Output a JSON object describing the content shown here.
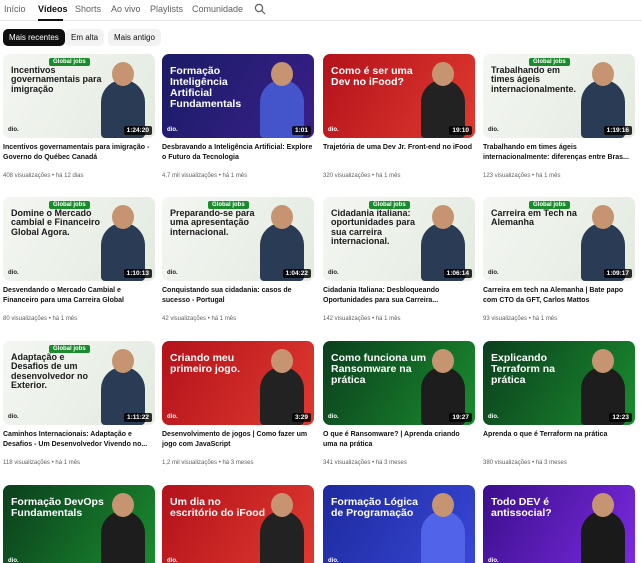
{
  "tabs": [
    {
      "label": "Início"
    },
    {
      "label": "Vídeos"
    },
    {
      "label": "Shorts"
    },
    {
      "label": "Ao vivo"
    },
    {
      "label": "Playlists"
    },
    {
      "label": "Comunidade"
    }
  ],
  "search_icon": "search-icon",
  "chips": [
    {
      "label": "Mais recentes",
      "selected": true
    },
    {
      "label": "Em alta",
      "selected": false
    },
    {
      "label": "Mais antigo",
      "selected": false
    }
  ],
  "videos": [
    {
      "title": "Incentivos governamentais para imigração - Governo do Québec Canadá",
      "views": "408 visualizações",
      "age": "há 12 dias",
      "duration": "1:24:20",
      "thumb_text": "Incentivos governamentais para imigração",
      "theme": "light"
    },
    {
      "title": "Desbravando a Inteligência Artificial: Explore o Futuro da Tecnologia",
      "views": "4,7 mil visualizações",
      "age": "há 1 mês",
      "duration": "1:01",
      "thumb_text": "Formação Inteligência Artificial Fundamentals",
      "theme": "navy"
    },
    {
      "title": "Trajetória de uma Dev Jr. Front-end no iFood",
      "views": "320 visualizações",
      "age": "há 1 mês",
      "duration": "19:10",
      "thumb_text": "Como é ser uma Dev no iFood?",
      "theme": "red"
    },
    {
      "title": "Trabalhando em times ágeis internacionalmente: diferenças entre Bras...",
      "views": "123 visualizações",
      "age": "há 1 mês",
      "duration": "1:19:16",
      "thumb_text": "Trabalhando em times ágeis internacionalmente.",
      "theme": "light"
    },
    {
      "title": "Desvendando o Mercado Cambial e Financeiro para uma Carreira Global",
      "views": "80 visualizações",
      "age": "há 1 mês",
      "duration": "1:10:13",
      "thumb_text": "Domine o Mercado cambial e Financeiro Global Agora.",
      "theme": "light"
    },
    {
      "title": "Conquistando sua cidadania: casos de sucesso - Portugal",
      "views": "42 visualizações",
      "age": "há 1 mês",
      "duration": "1:04:22",
      "thumb_text": "Preparando-se para uma apresentação internacional.",
      "theme": "light"
    },
    {
      "title": "Cidadania Italiana: Desbloqueando Oportunidades para sua Carreira...",
      "views": "142 visualizações",
      "age": "há 1 mês",
      "duration": "1:06:14",
      "thumb_text": "Cidadania italiana: oportunidades para sua carreira internacional.",
      "theme": "light"
    },
    {
      "title": "Carreira em tech na Alemanha | Bate papo com CTO da GFT, Carlos Mattos",
      "views": "93 visualizações",
      "age": "há 1 mês",
      "duration": "1:09:17",
      "thumb_text": "Carreira em Tech na Alemanha",
      "theme": "light"
    },
    {
      "title": "Caminhos Internacionais: Adaptação e Desafios - Um Desenvolvedor Vivendo no...",
      "views": "118 visualizações",
      "age": "há 1 mês",
      "duration": "1:11:22",
      "thumb_text": "Adaptação e Desafios de um desenvolvedor no Exterior.",
      "theme": "light"
    },
    {
      "title": "Desenvolvimento de jogos | Como fazer um jogo com JavaScript",
      "views": "1,2 mil visualizações",
      "age": "há 3 meses",
      "duration": "3:29",
      "thumb_text": "Criando meu primeiro jogo.",
      "theme": "red"
    },
    {
      "title": "O que é Ransomware? | Aprenda criando uma na prática",
      "views": "341 visualizações",
      "age": "há 3 meses",
      "duration": "19:27",
      "thumb_text": "Como funciona um Ransomware na prática",
      "theme": "green"
    },
    {
      "title": "Aprenda o que é Terraform na prática",
      "views": "380 visualizações",
      "age": "há 3 meses",
      "duration": "12:23",
      "thumb_text": "Explicando Terraform na prática",
      "theme": "green"
    },
    {
      "title": "",
      "views": "",
      "age": "",
      "duration": "",
      "thumb_text": "Formação DevOps Fundamentals",
      "theme": "green"
    },
    {
      "title": "",
      "views": "",
      "age": "",
      "duration": "",
      "thumb_text": "Um dia no escritório do iFood",
      "theme": "red"
    },
    {
      "title": "",
      "views": "",
      "age": "",
      "duration": "",
      "thumb_text": "Formação Lógica de Programação",
      "theme": "blue"
    },
    {
      "title": "",
      "views": "",
      "age": "",
      "duration": "",
      "thumb_text": "Todo DEV é antissocial?",
      "theme": "purple"
    }
  ],
  "colors": {
    "green": "#1a8c2e",
    "red": "#d9262c",
    "navy": "#1b1e6b",
    "blue": "#2431a8",
    "purple": "#6a1fd1",
    "light_bg": "#eef1ec"
  }
}
